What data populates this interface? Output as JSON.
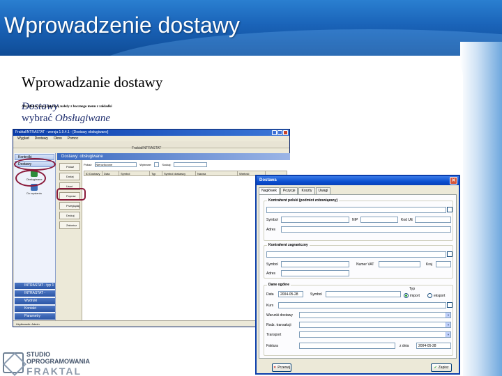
{
  "slide": {
    "title": "Wprowadzenie dostawy",
    "heading": "Wprowadzanie dostawy",
    "desc_text": "Aby dodać nową dostawę należy z bocznego menu z zakładki",
    "desc_em1": "Dostawy",
    "desc_text2": "wybrać",
    "desc_em2": "Obsługiwane",
    "colors": {
      "header_blue": "#1a63b8",
      "desc_text": "#1b2a6b",
      "highlight": "#8a1a3a"
    }
  },
  "logo": {
    "line1": "STUDIO",
    "line2": "OPROGRAMOWANIA",
    "line3": "FRAKTAL"
  },
  "app": {
    "window_title": "FraktalINTRASTAT - wersja 1.9.4.1 - [Dostawy obsługiwane]",
    "menu": [
      "Wyglad",
      "Dostawy",
      "Okno",
      "Pomoc"
    ],
    "app_name": "FraktalINTRASTAT",
    "sidebar": {
      "group_top": "Kontrolki",
      "item_highlighted": "Dostawy",
      "icon1_label": "Obsługiwane",
      "icon2_label": "Do wysłania",
      "bottom_items": [
        "INTRASTAT - typ 1",
        "INTRASTAT - Wysyłka",
        "Wydruki",
        "Kontakt",
        "Parametry"
      ]
    },
    "content": {
      "header": "Dostawy: obsługiwane",
      "filter_label": "Pokaż:",
      "filter_value": "Nierozliczone",
      "check_label": "Wybrane:",
      "search_label": "Szukaj:",
      "tools": [
        "Pokaż",
        "Dodaj",
        "Usuń",
        "Popraw",
        "Przeglądaj",
        "Drukuj",
        "Zakończ"
      ],
      "columns": [
        "ID Dostawy",
        "Data",
        "Symbol",
        "Typ",
        "Symbol dostawcy",
        "Nazwa",
        "Wartość"
      ]
    },
    "status": "Użytkownik: Admin"
  },
  "dialog": {
    "title": "Dostawa",
    "close": "✕",
    "tabs": [
      "Nagłówek",
      "Pozycje",
      "Koszty",
      "Uwagi"
    ],
    "section1": {
      "legend": "Kontrahent polski (podmiot zobowiązany)",
      "symbol_label": "Symbol",
      "nip_label": "NIP",
      "regon_label": "Kod UE",
      "adres_label": "Adres"
    },
    "section2": {
      "legend": "Kontrahent zagraniczny",
      "symbol_label": "Symbol",
      "vat_label": "Numer VAT",
      "kraj_label": "Kraj",
      "adres_label": "Adres"
    },
    "section3": {
      "legend": "Dane ogólne",
      "data_label": "Data",
      "data_value": "2004-05-28",
      "symbol_label": "Symbol",
      "typ_label": "Typ",
      "import_label": "import",
      "eksport_label": "eksport",
      "kurs_label": "Kurs",
      "warunki_label": "Warunki dostawy",
      "rodzaj_label": "Rodz. transakcji",
      "transport_label": "Transport",
      "faktura_label": "Faktura",
      "zdnia_label": "z dnia",
      "zdnia_value": "2004-05-28"
    },
    "buttons": {
      "cancel": "Przerwij",
      "ok": "Zapisz"
    }
  }
}
